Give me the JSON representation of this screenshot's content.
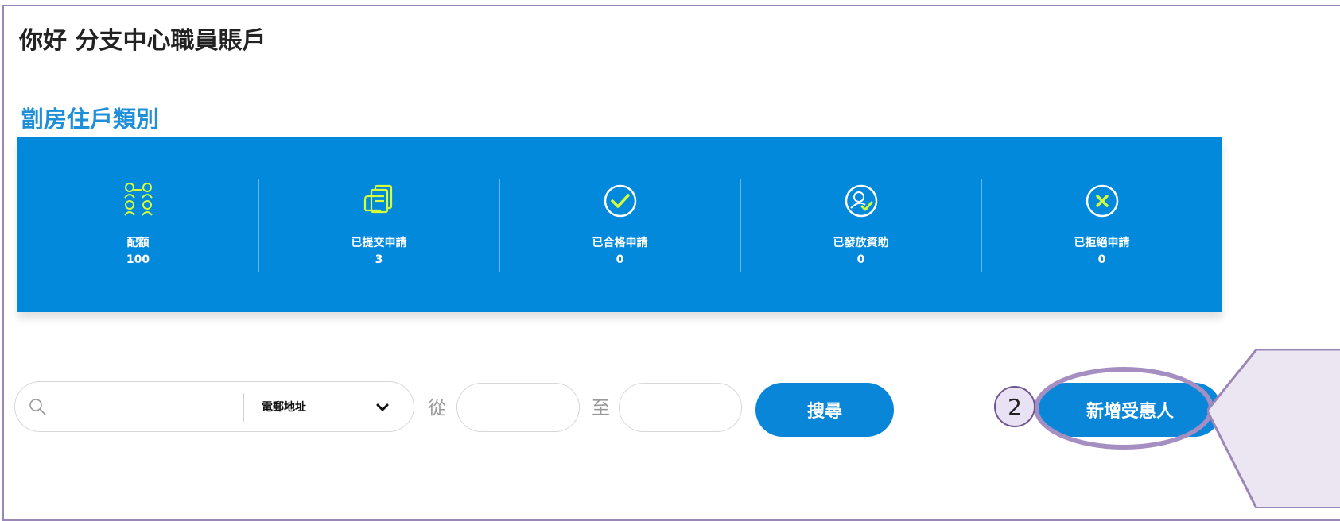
{
  "header": {
    "greeting": "你好 分支中心職員賬戶"
  },
  "section": {
    "title": "劏房住戶類別"
  },
  "stats": [
    {
      "icon": "quota-people-icon",
      "label": "配額",
      "value": "100"
    },
    {
      "icon": "submitted-documents-icon",
      "label": "已提交申請",
      "value": "3"
    },
    {
      "icon": "check-circle-icon",
      "label": "已合格申請",
      "value": "0"
    },
    {
      "icon": "person-check-icon",
      "label": "已發放資助",
      "value": "0"
    },
    {
      "icon": "x-circle-icon",
      "label": "已拒絕申請",
      "value": "0"
    }
  ],
  "search": {
    "input_value": "",
    "field_selected": "電郵地址",
    "from_label": "從",
    "to_label": "至",
    "from_value": "",
    "to_value": "",
    "search_button": "搜尋"
  },
  "actions": {
    "add_beneficiary": "新增受惠人"
  },
  "annotation": {
    "step_number": "2"
  },
  "colors": {
    "banner": "#0289dc",
    "button": "#0a86d8",
    "title": "#1f8fd8",
    "icon_accent": "#d6ff3a",
    "annotation_purple": "#a58fc2"
  }
}
